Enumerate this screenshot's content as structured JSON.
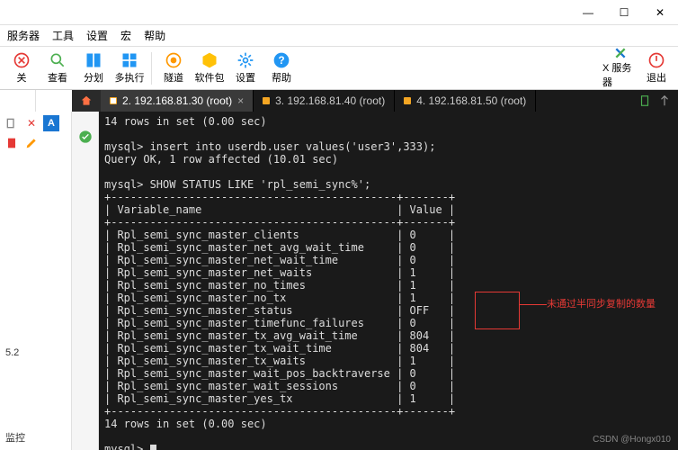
{
  "window": {
    "min": "—",
    "max": "☐",
    "close": "✕"
  },
  "menu": {
    "m0": "服务器",
    "m1": "工具",
    "m2": "设置",
    "m3": "宏",
    "m4": "帮助"
  },
  "toolbar": {
    "t0": "关",
    "t1": "查看",
    "t2": "分划",
    "t3": "多执行",
    "t4": "隧道",
    "t5": "软件包",
    "t6": "设置",
    "t7": "帮助",
    "t8": "X 服务器",
    "t9": "退出"
  },
  "tabs": {
    "t0": "2. 192.168.81.30 (root)",
    "t1": "3. 192.168.81.40 (root)",
    "t2": "4. 192.168.81.50 (root)"
  },
  "sidebar": {
    "ver": "5.2",
    "mon": "监控"
  },
  "term": {
    "l0": "14 rows in set (0.00 sec)",
    "l1": "",
    "l2": "mysql> insert into userdb.user values('user3',333);",
    "l3": "Query OK, 1 row affected (10.01 sec)",
    "l4": "",
    "l5": "mysql> SHOW STATUS LIKE 'rpl_semi_sync%';",
    "l6": "+--------------------------------------------+-------+",
    "l7": "| Variable_name                              | Value |",
    "l8": "+--------------------------------------------+-------+",
    "r0n": "Rpl_semi_sync_master_clients",
    "r0v": "0",
    "r1n": "Rpl_semi_sync_master_net_avg_wait_time",
    "r1v": "0",
    "r2n": "Rpl_semi_sync_master_net_wait_time",
    "r2v": "0",
    "r3n": "Rpl_semi_sync_master_net_waits",
    "r3v": "1",
    "r4n": "Rpl_semi_sync_master_no_times",
    "r4v": "1",
    "r5n": "Rpl_semi_sync_master_no_tx",
    "r5v": "1",
    "r6n": "Rpl_semi_sync_master_status",
    "r6v": "OFF",
    "r7n": "Rpl_semi_sync_master_timefunc_failures",
    "r7v": "0",
    "r8n": "Rpl_semi_sync_master_tx_avg_wait_time",
    "r8v": "804",
    "r9n": "Rpl_semi_sync_master_tx_wait_time",
    "r9v": "804",
    "r10n": "Rpl_semi_sync_master_tx_waits",
    "r10v": "1",
    "r11n": "Rpl_semi_sync_master_wait_pos_backtraverse",
    "r11v": "0",
    "r12n": "Rpl_semi_sync_master_wait_sessions",
    "r12v": "0",
    "r13n": "Rpl_semi_sync_master_yes_tx",
    "r13v": "1",
    "l9": "+--------------------------------------------+-------+",
    "l10": "14 rows in set (0.00 sec)",
    "l11": "",
    "l12": "mysql> ",
    "annot": "未通过半同步复制的数量"
  },
  "watermark": "CSDN @Hongx010"
}
